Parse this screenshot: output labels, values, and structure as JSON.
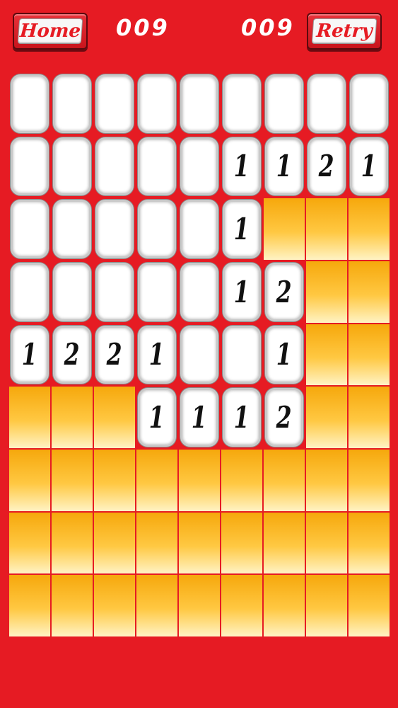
{
  "header": {
    "home_label": "Home",
    "retry_label": "Retry",
    "mine_counter": "009",
    "timer": "009"
  },
  "colors": {
    "background": "#e61b23",
    "hidden_tile": "#ffc842",
    "revealed_tile": "#ffffff"
  },
  "board": {
    "rows": 9,
    "cols": 9,
    "cells": [
      [
        "",
        "",
        "",
        "",
        "",
        "",
        "",
        "",
        ""
      ],
      [
        "",
        "",
        "",
        "",
        "",
        "1",
        "1",
        "2",
        "1"
      ],
      [
        "",
        "",
        "",
        "",
        "",
        "1",
        "#",
        "#",
        "#"
      ],
      [
        "",
        "",
        "",
        "",
        "",
        "1",
        "2",
        "#",
        "#"
      ],
      [
        "1",
        "2",
        "2",
        "1",
        "",
        "",
        "1",
        "#",
        "#"
      ],
      [
        "#",
        "#",
        "#",
        "1",
        "1",
        "1",
        "2",
        "#",
        "#"
      ],
      [
        "#",
        "#",
        "#",
        "#",
        "#",
        "#",
        "#",
        "#",
        "#"
      ],
      [
        "#",
        "#",
        "#",
        "#",
        "#",
        "#",
        "#",
        "#",
        "#"
      ],
      [
        "#",
        "#",
        "#",
        "#",
        "#",
        "#",
        "#",
        "#",
        "#"
      ]
    ]
  }
}
